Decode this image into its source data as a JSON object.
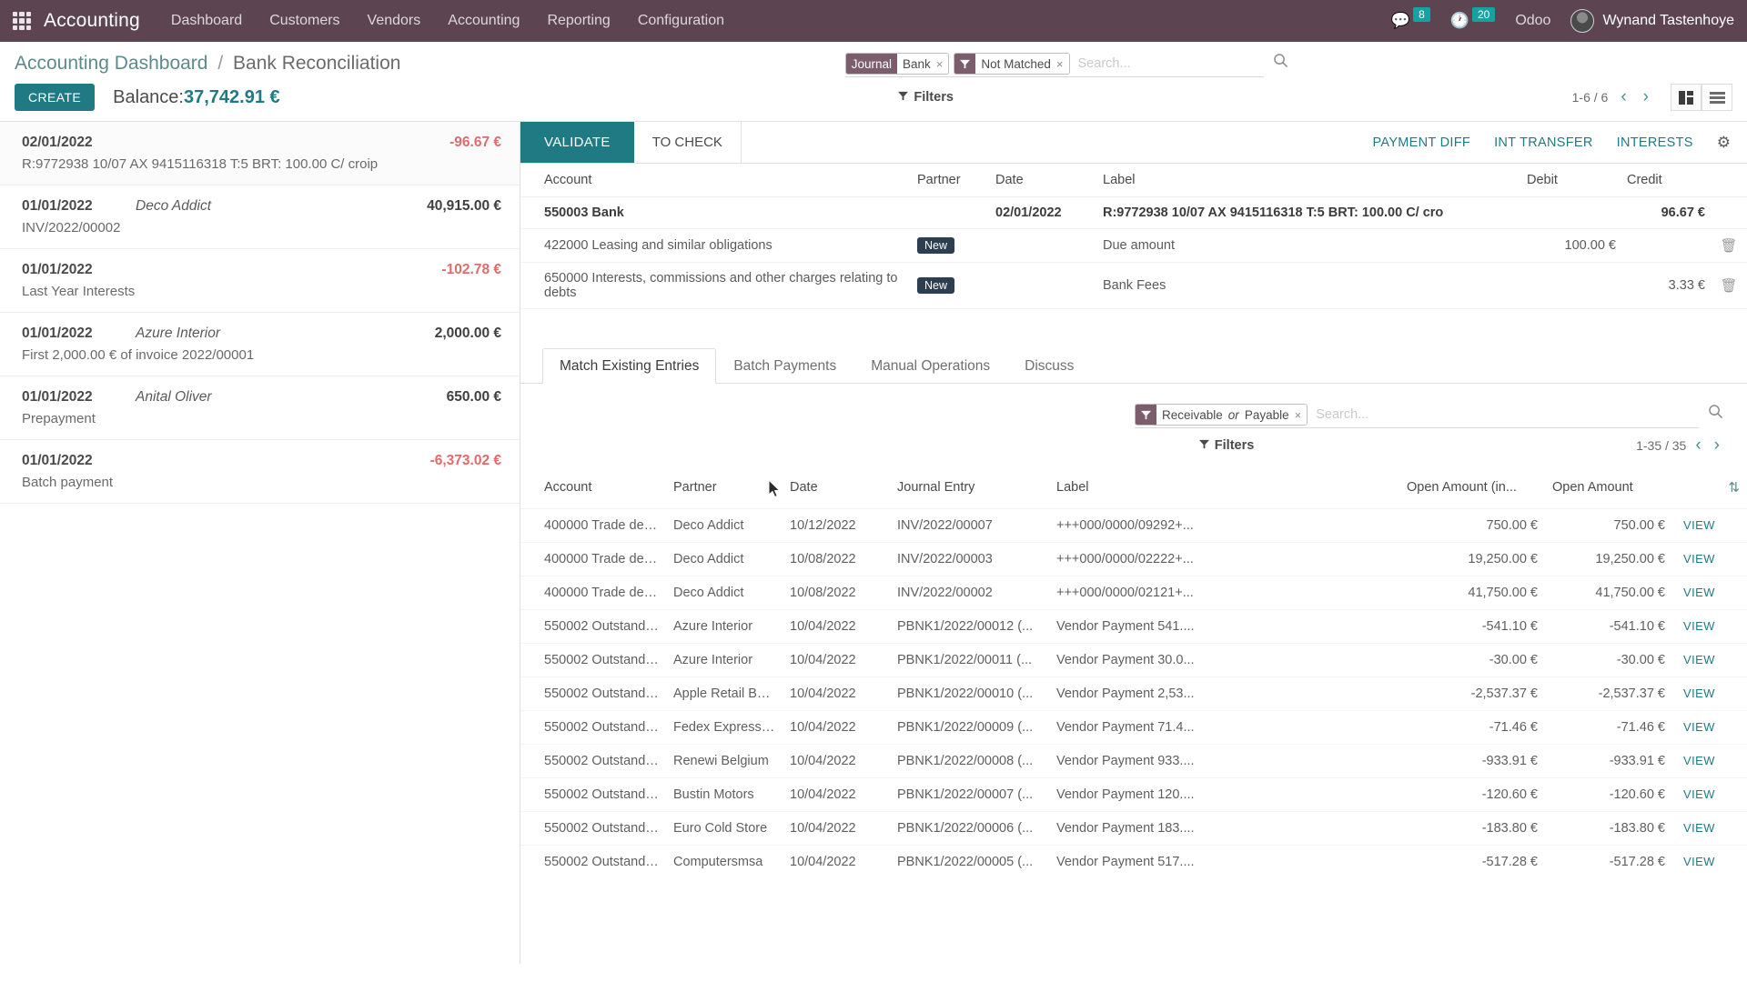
{
  "navbar": {
    "apps_icon": "apps-grid-icon",
    "brand": "Accounting",
    "menu": [
      "Dashboard",
      "Customers",
      "Vendors",
      "Accounting",
      "Reporting",
      "Configuration"
    ],
    "messages_icon": "chat-icon",
    "messages_count": "8",
    "activities_icon": "clock-icon",
    "activities_count": "20",
    "odoo_label": "Odoo",
    "avatar_icon": "avatar",
    "user_name": "Wynand Tastenhoye"
  },
  "control_panel": {
    "breadcrumb_parent": "Accounting Dashboard",
    "breadcrumb_sep": "/",
    "breadcrumb_current": "Bank Reconciliation",
    "create_label": "CREATE",
    "balance_prefix": "Balance:",
    "balance_value": "37,742.91 €",
    "search": {
      "facets": [
        {
          "head": "Journal",
          "value": "Bank",
          "remove": "×",
          "icon": ""
        },
        {
          "head": "",
          "value": "Not Matched",
          "remove": "×",
          "icon": "filter-icon"
        }
      ],
      "placeholder": "Search...",
      "search_icon": "search-icon"
    },
    "filters_label": "Filters",
    "pager_text": "1-6 / 6",
    "prev_icon": "chevron-left-icon",
    "next_icon": "chevron-right-icon",
    "view_kanban_icon": "kanban-view-icon",
    "view_list_icon": "list-view-icon"
  },
  "statement_lines": [
    {
      "date": "02/01/2022",
      "partner": "",
      "amount": "-96.67 €",
      "negative": true,
      "label": "R:9772938 10/07 AX 9415116318 T:5 BRT: 100.00 C/ croip",
      "selected": true
    },
    {
      "date": "01/01/2022",
      "partner": "Deco Addict",
      "amount": "40,915.00 €",
      "negative": false,
      "label": "INV/2022/00002",
      "selected": false
    },
    {
      "date": "01/01/2022",
      "partner": "",
      "amount": "-102.78 €",
      "negative": true,
      "label": "Last Year Interests",
      "selected": false
    },
    {
      "date": "01/01/2022",
      "partner": "Azure Interior",
      "amount": "2,000.00 €",
      "negative": false,
      "label": "First 2,000.00 € of invoice 2022/00001",
      "selected": false
    },
    {
      "date": "01/01/2022",
      "partner": "Anital Oliver",
      "amount": "650.00 €",
      "negative": false,
      "label": "Prepayment",
      "selected": false
    },
    {
      "date": "01/01/2022",
      "partner": "",
      "amount": "-6,373.02 €",
      "negative": true,
      "label": "Batch payment",
      "selected": false
    }
  ],
  "reconcile": {
    "validate_label": "VALIDATE",
    "to_check_label": "TO CHECK",
    "actions": [
      "PAYMENT DIFF",
      "INT TRANSFER",
      "INTERESTS"
    ],
    "gear_icon": "gear-icon",
    "headers": {
      "account": "Account",
      "partner": "Partner",
      "date": "Date",
      "label": "Label",
      "debit": "Debit",
      "credit": "Credit"
    },
    "rows": [
      {
        "account": "550003 Bank",
        "partner": "",
        "date": "02/01/2022",
        "label": "R:9772938 10/07 AX 9415116318 T:5 BRT: 100.00 C/ cro",
        "debit": "",
        "credit": "96.67 €",
        "highlight": true,
        "trash": false
      },
      {
        "account": "422000 Leasing and similar obligations",
        "partner": "New",
        "date": "",
        "label": "Due amount",
        "debit": "100.00 €",
        "credit": "",
        "highlight": false,
        "trash": true,
        "trash_icon": "trash-icon"
      },
      {
        "account": "650000 Interests, commissions and other charges relating to debts",
        "partner": "New",
        "date": "",
        "label": "Bank Fees",
        "debit": "",
        "credit": "3.33 €",
        "highlight": false,
        "trash": true,
        "trash_icon": "trash-icon"
      }
    ]
  },
  "tabs": [
    {
      "label": "Match Existing Entries",
      "active": true
    },
    {
      "label": "Batch Payments",
      "active": false
    },
    {
      "label": "Manual Operations",
      "active": false
    },
    {
      "label": "Discuss",
      "active": false
    }
  ],
  "inner_search": {
    "facet_icon": "filter-icon",
    "facet_text_a": "Receivable",
    "facet_text_em": "or",
    "facet_text_b": "Payable",
    "facet_remove": "×",
    "placeholder": "Search...",
    "search_icon": "search-icon",
    "filters_label": "Filters",
    "pager_text": "1-35 / 35",
    "prev_icon": "chevron-left-icon",
    "next_icon": "chevron-right-icon"
  },
  "match_table": {
    "headers": {
      "account": "Account",
      "partner": "Partner",
      "date": "Date",
      "journal_entry": "Journal Entry",
      "label": "Label",
      "open_amount_in": "Open Amount (in...",
      "open_amount": "Open Amount",
      "options_icon": "column-options-icon"
    },
    "view_label": "VIEW",
    "rows": [
      {
        "account": "400000 Trade debt...",
        "partner": "Deco Addict",
        "date": "10/12/2022",
        "journal_entry": "INV/2022/00007",
        "label": "+++000/0000/09292+...",
        "open_in": "750.00 €",
        "open": "750.00 €",
        "negative": false
      },
      {
        "account": "400000 Trade debt...",
        "partner": "Deco Addict",
        "date": "10/08/2022",
        "journal_entry": "INV/2022/00003",
        "label": "+++000/0000/02222+...",
        "open_in": "19,250.00 €",
        "open": "19,250.00 €",
        "negative": false
      },
      {
        "account": "400000 Trade debt...",
        "partner": "Deco Addict",
        "date": "10/08/2022",
        "journal_entry": "INV/2022/00002",
        "label": "+++000/0000/02121+...",
        "open_in": "41,750.00 €",
        "open": "41,750.00 €",
        "negative": false
      },
      {
        "account": "550002 Outstandin...",
        "partner": "Azure Interior",
        "date": "10/04/2022",
        "journal_entry": "PBNK1/2022/00012 (...",
        "label": "Vendor Payment 541....",
        "open_in": "-541.10 €",
        "open": "-541.10 €",
        "negative": true
      },
      {
        "account": "550002 Outstandin...",
        "partner": "Azure Interior",
        "date": "10/04/2022",
        "journal_entry": "PBNK1/2022/00011 (...",
        "label": "Vendor Payment 30.0...",
        "open_in": "-30.00 €",
        "open": "-30.00 €",
        "negative": true
      },
      {
        "account": "550002 Outstandin...",
        "partner": "Apple Retail Belgium",
        "date": "10/04/2022",
        "journal_entry": "PBNK1/2022/00010 (...",
        "label": "Vendor Payment 2,53...",
        "open_in": "-2,537.37 €",
        "open": "-2,537.37 €",
        "negative": true
      },
      {
        "account": "550002 Outstandin...",
        "partner": "Fedex Express Belgiu...",
        "date": "10/04/2022",
        "journal_entry": "PBNK1/2022/00009 (...",
        "label": "Vendor Payment 71.4...",
        "open_in": "-71.46 €",
        "open": "-71.46 €",
        "negative": true
      },
      {
        "account": "550002 Outstandin...",
        "partner": "Renewi Belgium",
        "date": "10/04/2022",
        "journal_entry": "PBNK1/2022/00008 (...",
        "label": "Vendor Payment 933....",
        "open_in": "-933.91 €",
        "open": "-933.91 €",
        "negative": true
      },
      {
        "account": "550002 Outstandin...",
        "partner": "Bustin Motors",
        "date": "10/04/2022",
        "journal_entry": "PBNK1/2022/00007 (...",
        "label": "Vendor Payment 120....",
        "open_in": "-120.60 €",
        "open": "-120.60 €",
        "negative": true
      },
      {
        "account": "550002 Outstandin...",
        "partner": "Euro Cold Store",
        "date": "10/04/2022",
        "journal_entry": "PBNK1/2022/00006 (...",
        "label": "Vendor Payment 183....",
        "open_in": "-183.80 €",
        "open": "-183.80 €",
        "negative": true
      },
      {
        "account": "550002 Outstandin...",
        "partner": "Computersmsa",
        "date": "10/04/2022",
        "journal_entry": "PBNK1/2022/00005 (...",
        "label": "Vendor Payment 517....",
        "open_in": "-517.28 €",
        "open": "-517.28 €",
        "negative": true
      }
    ]
  },
  "colors": {
    "navbar_bg": "#5c4550",
    "accent_teal": "#1f7a84",
    "negative_red": "#e26a6a",
    "facet_head": "#7c5d6b"
  }
}
